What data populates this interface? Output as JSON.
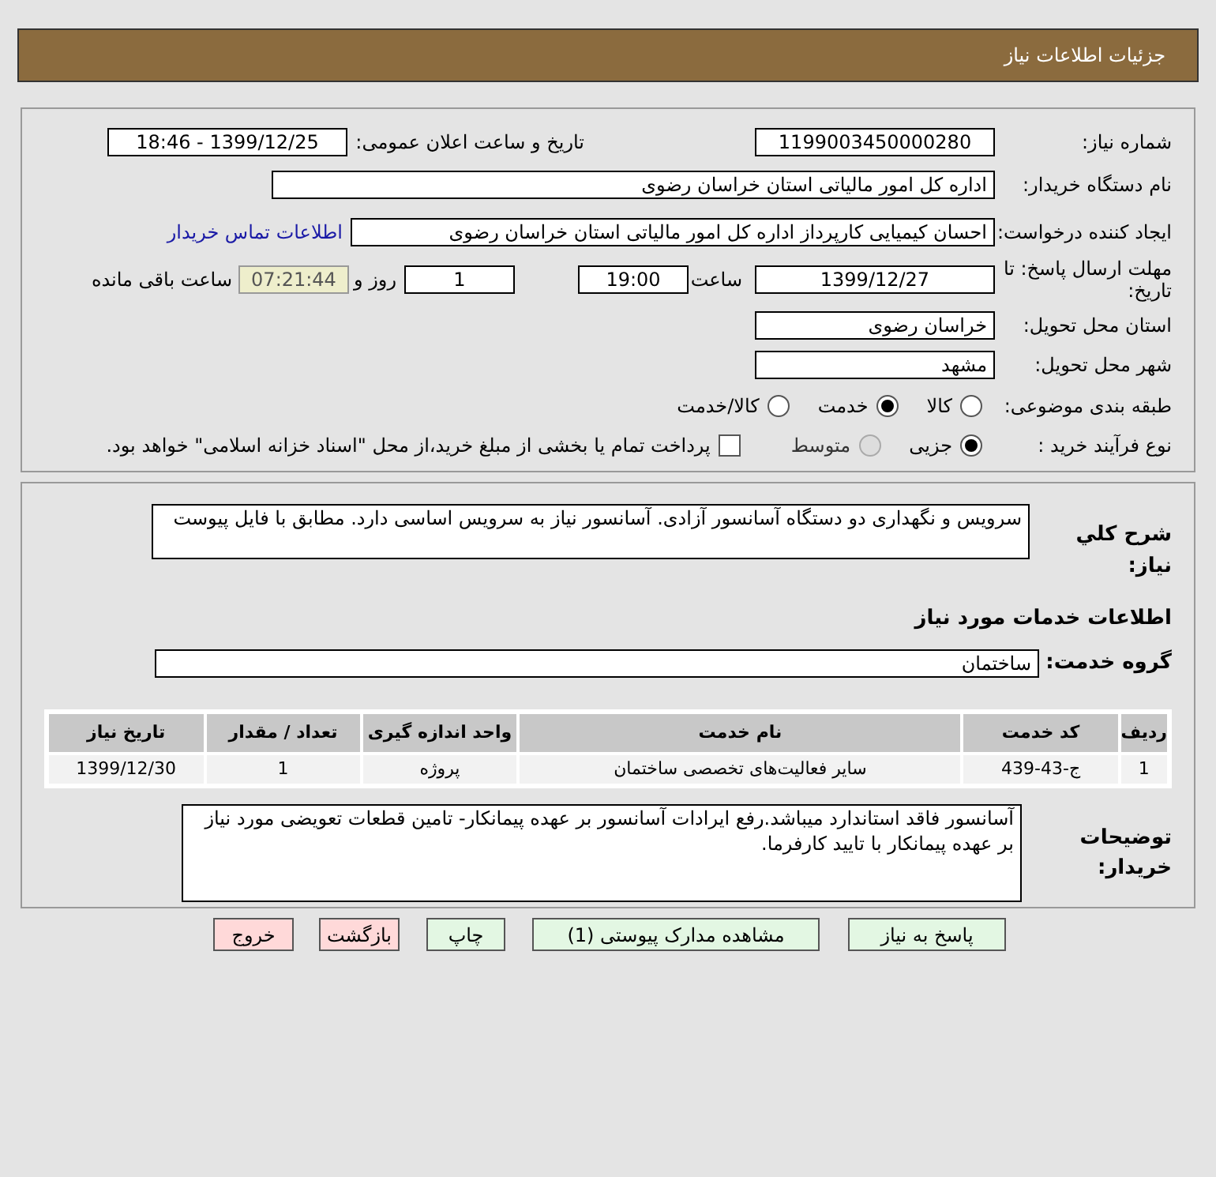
{
  "header": {
    "title": "جزئیات اطلاعات نیاز"
  },
  "need_number": {
    "label": "شماره نیاز:",
    "value": "1199003450000280"
  },
  "announce": {
    "label": "تاریخ و ساعت اعلان عمومی:",
    "value": "1399/12/25 - 18:46"
  },
  "buyer": {
    "label": "نام دستگاه خریدار:",
    "value": "اداره کل امور مالیاتی استان خراسان رضوی"
  },
  "creator": {
    "label": "ایجاد کننده درخواست:",
    "value": "احسان کیمیایی کارپرداز اداره کل امور مالیاتی استان خراسان رضوی",
    "link": "اطلاعات تماس خریدار"
  },
  "deadline": {
    "label": "مهلت ارسال پاسخ: تا تاریخ:",
    "date": "1399/12/27",
    "time_label": "ساعت",
    "time": "19:00",
    "days": "1",
    "days_label": "روز و",
    "remaining": "07:21:44",
    "remaining_label": "ساعت باقی مانده"
  },
  "province": {
    "label": "استان محل تحویل:",
    "value": "خراسان رضوی"
  },
  "city": {
    "label": "شهر محل تحویل:",
    "value": "مشهد"
  },
  "category": {
    "label": "طبقه بندی موضوعی:",
    "options": [
      {
        "label": "کالا",
        "selected": false,
        "disabled": false
      },
      {
        "label": "خدمت",
        "selected": true,
        "disabled": false
      },
      {
        "label": "کالا/خدمت",
        "selected": false,
        "disabled": false
      }
    ]
  },
  "process": {
    "label": "نوع فرآیند خرید :",
    "options": [
      {
        "label": "جزیی",
        "selected": true,
        "disabled": false
      },
      {
        "label": "متوسط",
        "selected": false,
        "disabled": true
      }
    ],
    "payment": {
      "checked": false,
      "text": "پرداخت تمام یا بخشی از مبلغ خرید،از محل \"اسناد خزانه اسلامی\" خواهد بود."
    }
  },
  "description": {
    "label": "شرح کلي نیاز:",
    "value": "سرویس و نگهداری دو دستگاه آسانسور آزادی. آسانسور نیاز به سرویس اساسی دارد. مطابق با فایل پیوست"
  },
  "services_heading": "اطلاعات خدمات مورد نیاز",
  "service_group": {
    "label": "گروه خدمت:",
    "value": "ساختمان"
  },
  "table": {
    "columns": [
      "ردیف",
      "کد خدمت",
      "نام خدمت",
      "واحد اندازه گیری",
      "تعداد / مقدار",
      "تاریخ نیاز"
    ],
    "rows": [
      [
        "1",
        "ج-43-439",
        "سایر فعالیت‌های تخصصی ساختمان",
        "پروژه",
        "1",
        "1399/12/30"
      ]
    ]
  },
  "buyer_notes": {
    "label": "توضیحات خریدار:",
    "value": "آسانسور فاقد استاندارد میباشد.رفع ایرادات آسانسور بر عهده پیمانکار- تامین قطعات تعویضی مورد نیاز بر عهده پیمانکار با تایید کارفرما."
  },
  "buttons": [
    {
      "label": "پاسخ به نیاز",
      "kind": "action"
    },
    {
      "label": "مشاهده مدارک پیوستی (1)",
      "kind": "action"
    },
    {
      "label": "چاپ",
      "kind": "action"
    },
    {
      "label": "بازگشت",
      "kind": "danger"
    },
    {
      "label": "خروج",
      "kind": "danger"
    }
  ]
}
